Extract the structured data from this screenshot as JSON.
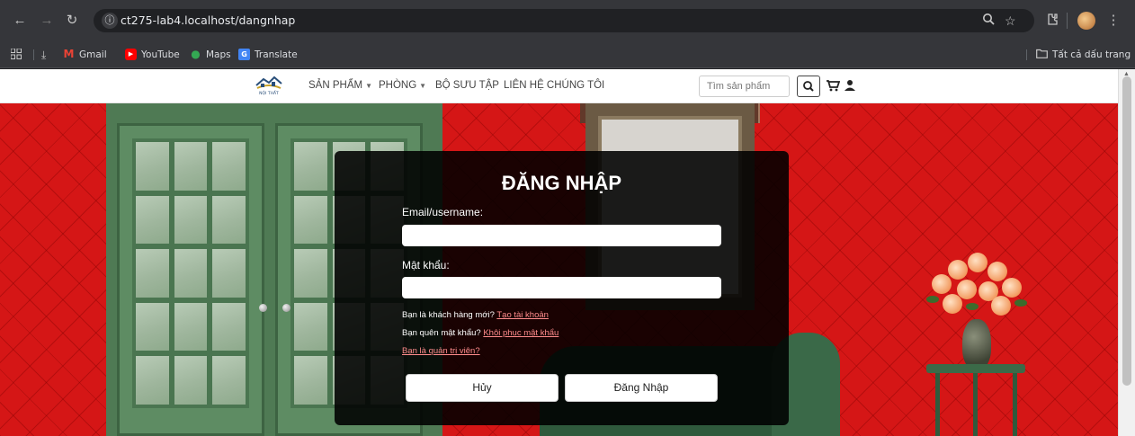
{
  "browser": {
    "url": "ct275-lab4.localhost/dangnhap",
    "bookmarks": [
      {
        "label": "Gmail",
        "icon": "gmail-icon"
      },
      {
        "label": "YouTube",
        "icon": "youtube-icon"
      },
      {
        "label": "Maps",
        "icon": "maps-icon"
      },
      {
        "label": "Translate",
        "icon": "translate-icon"
      }
    ],
    "all_bookmarks_label": "Tất cả dấu trang"
  },
  "site_nav": {
    "logo_text": "NỘI THẤT",
    "menu": [
      {
        "label": "SẢN PHẨM",
        "has_dropdown": true
      },
      {
        "label": "PHÒNG",
        "has_dropdown": true
      },
      {
        "label": "BỘ SƯU TẬP",
        "has_dropdown": false
      },
      {
        "label": "LIÊN HỆ CHÚNG TÔI",
        "has_dropdown": false
      }
    ],
    "search_placeholder": "Tìm sản phẩm"
  },
  "login": {
    "title": "ĐĂNG NHẬP",
    "email_label": "Email/username:",
    "email_value": "",
    "password_label": "Mật khẩu:",
    "password_value": "",
    "new_customer_text": "Bạn là khách hàng mới?",
    "create_account_link": "Tạo tài khoản",
    "forgot_text": "Bạn quên mật khẩu?",
    "recover_link": "Khôi phục mật khẩu",
    "admin_link": "Bạn là quản trị viên?",
    "cancel_label": "Hủy",
    "submit_label": "Đăng Nhập"
  },
  "colors": {
    "wall": "#d51616",
    "card_bg": "#000000",
    "link": "#ff8c8c",
    "door": "#5e8c63"
  }
}
